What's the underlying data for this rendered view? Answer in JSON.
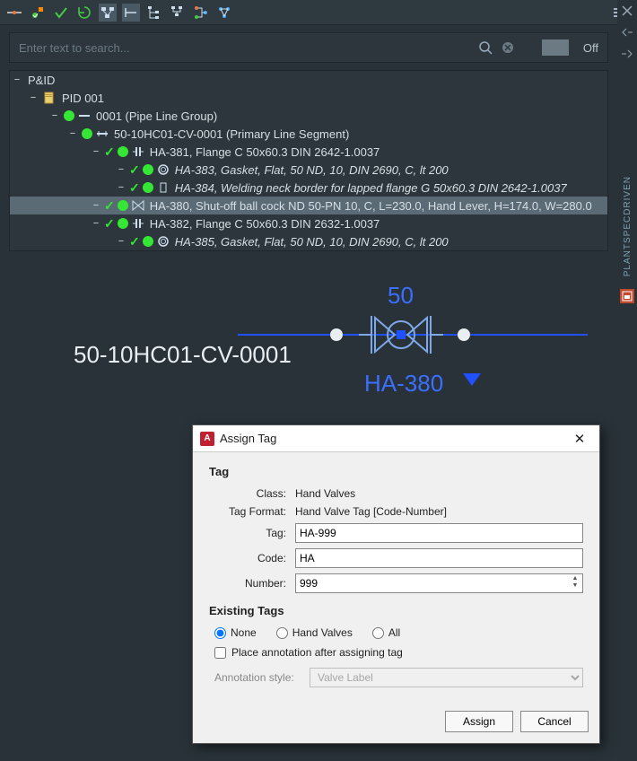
{
  "search": {
    "placeholder_text": "Enter text to search...",
    "toggle_label": "Off"
  },
  "right_strip": {
    "vertical_label": "PLANTSPECDRIVEN"
  },
  "tree": {
    "root_label": "P&ID",
    "doc_label": "PID 001",
    "pipe_group_label": "0001 (Pipe Line Group)",
    "primary_segment_label": "50-10HC01-CV-0001 (Primary Line Segment)",
    "ha381_label": "HA-381, Flange C 50x60.3 DIN 2642-1.0037",
    "ha383_label": "HA-383, Gasket, Flat, 50 ND, 10, DIN 2690, C, lt 200",
    "ha384_label": "HA-384, Welding neck border for lapped flange G 50x60.3 DIN 2642-1.0037",
    "ha380_label": "HA-380, Shut-off ball cock ND 50-PN 10, C, L=230.0, Hand Lever, H=174.0, W=280.0",
    "ha382_label": "HA-382, Flange C 50x60.3 DIN 2632-1.0037",
    "ha385_label": "HA-385, Gasket, Flat, 50 ND, 10, DIN 2690, C, lt 200"
  },
  "canvas": {
    "top_label": "50",
    "line_id": "50-10HC01-CV-0001",
    "component_tag": "HA-380"
  },
  "dialog": {
    "title": "Assign Tag",
    "section_tag": "Tag",
    "class_label": "Class:",
    "class_value": "Hand Valves",
    "format_label": "Tag Format:",
    "format_value": "Hand Valve Tag [Code-Number]",
    "tag_label": "Tag:",
    "tag_value": "HA-999",
    "code_label": "Code:",
    "code_value": "HA",
    "number_label": "Number:",
    "number_value": "999",
    "existing_section": "Existing Tags",
    "radio_none": "None",
    "radio_hand": "Hand Valves",
    "radio_all": "All",
    "check_anno": "Place annotation after assigning tag",
    "anno_label": "Annotation style:",
    "anno_value": "Valve Label",
    "btn_assign": "Assign",
    "btn_cancel": "Cancel"
  }
}
